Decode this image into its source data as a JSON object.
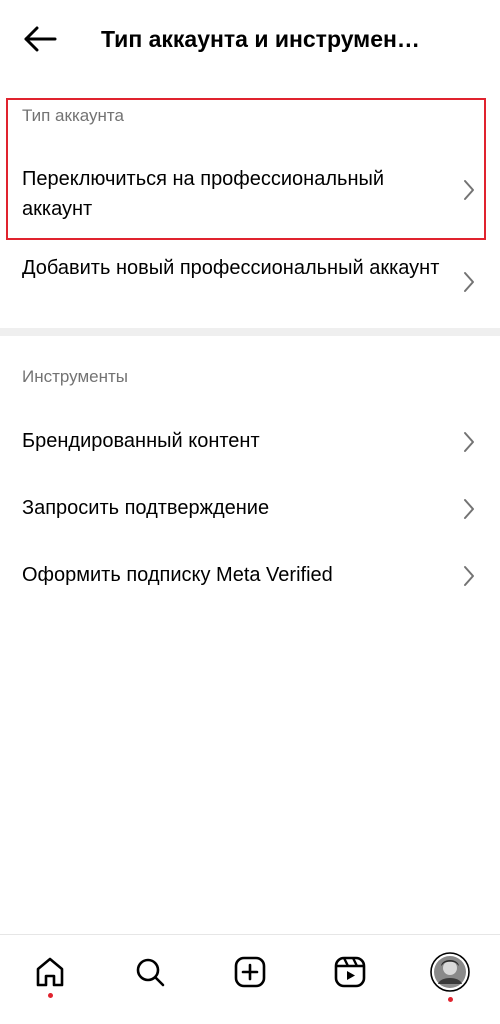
{
  "header": {
    "title": "Тип аккаунта и инструмен…",
    "back_icon": "arrow-left-icon"
  },
  "account_type_section": {
    "label": "Тип аккаунта",
    "items": [
      {
        "label": "Переключиться на профессиональный аккаунт",
        "icon": "chevron-right-icon"
      },
      {
        "label": "Добавить новый профессиональный аккаунт",
        "icon": "chevron-right-icon"
      }
    ]
  },
  "tools_section": {
    "label": "Инструменты",
    "items": [
      {
        "label": "Брендированный контент",
        "icon": "chevron-right-icon"
      },
      {
        "label": "Запросить подтверждение",
        "icon": "chevron-right-icon"
      },
      {
        "label": "Оформить подписку Meta Verified",
        "icon": "chevron-right-icon"
      }
    ]
  },
  "bottom_nav": {
    "items": [
      {
        "icon": "home-icon",
        "notification": true
      },
      {
        "icon": "search-icon",
        "notification": false
      },
      {
        "icon": "create-post-icon",
        "notification": false
      },
      {
        "icon": "reels-icon",
        "notification": false
      },
      {
        "icon": "profile-avatar",
        "notification": true
      }
    ]
  },
  "colors": {
    "highlight": "#e0232e",
    "secondary_text": "#737373",
    "divider": "#efefef"
  }
}
